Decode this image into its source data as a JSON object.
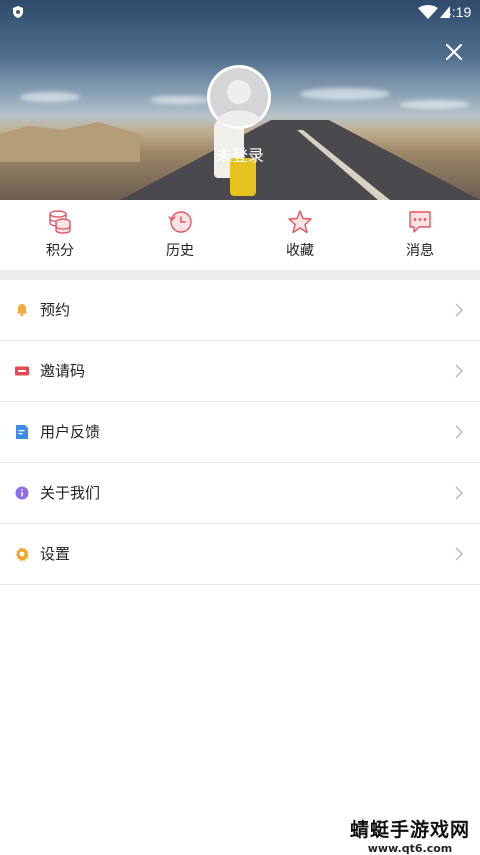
{
  "status_bar": {
    "time": "4:19"
  },
  "header": {
    "login_text": "未登录"
  },
  "actions": [
    {
      "label": "积分",
      "icon": "coins-icon"
    },
    {
      "label": "历史",
      "icon": "history-icon"
    },
    {
      "label": "收藏",
      "icon": "star-icon"
    },
    {
      "label": "消息",
      "icon": "message-icon"
    }
  ],
  "menu": [
    {
      "label": "预约",
      "icon": "bell-icon"
    },
    {
      "label": "邀请码",
      "icon": "ticket-icon"
    },
    {
      "label": "用户反馈",
      "icon": "feedback-icon"
    },
    {
      "label": "关于我们",
      "icon": "info-icon"
    },
    {
      "label": "设置",
      "icon": "settings-icon"
    }
  ],
  "watermark": {
    "line1": "蜻蜓手游戏网",
    "line2": "www.qt6.com"
  },
  "colors": {
    "accent": "#e25560",
    "divider": "#eeeeee",
    "bell": "#f2a93b",
    "ticket": "#e8484f",
    "feedback": "#3b8fe6",
    "info": "#8c6fe6",
    "settings": "#f0a420"
  }
}
